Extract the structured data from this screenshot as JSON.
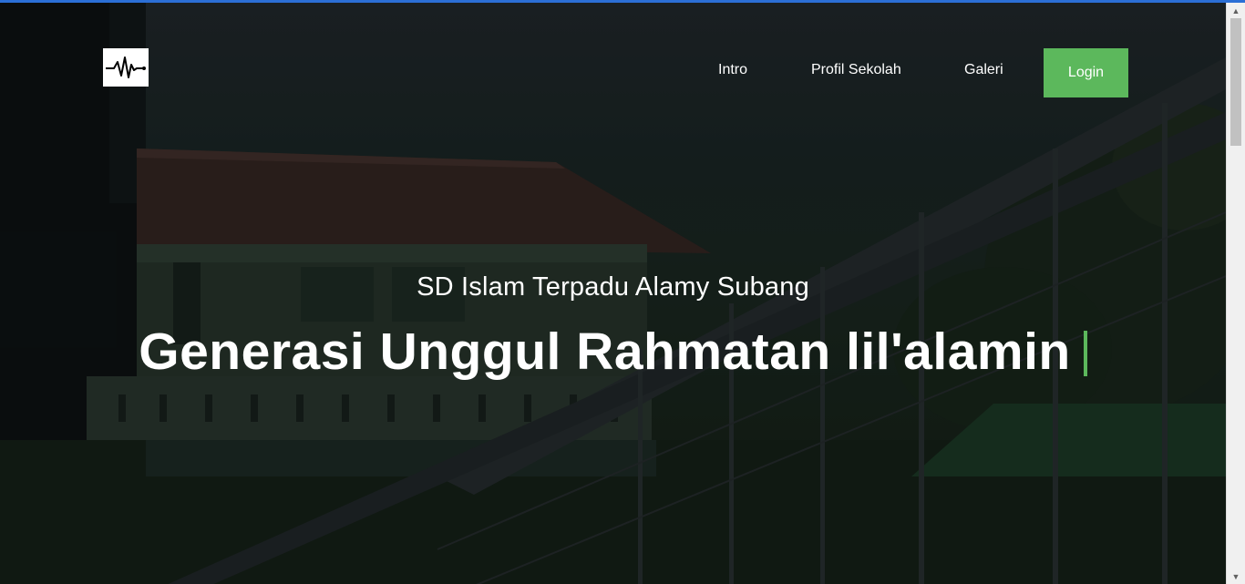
{
  "logo": {
    "icon": "heartbeat-icon"
  },
  "nav": {
    "items": [
      {
        "label": "Intro"
      },
      {
        "label": "Profil Sekolah"
      },
      {
        "label": "Galeri"
      }
    ],
    "login_label": "Login"
  },
  "hero": {
    "subtitle": "SD Islam Terpadu Alamy Subang",
    "headline": "Generasi Unggul Rahmatan lil'alamin",
    "background": "school-building-photo"
  },
  "colors": {
    "accent": "#5cb85c",
    "text": "#ffffff",
    "logo_bg": "#ffffff"
  },
  "scrollbar": {
    "position_fraction": 0.0
  }
}
